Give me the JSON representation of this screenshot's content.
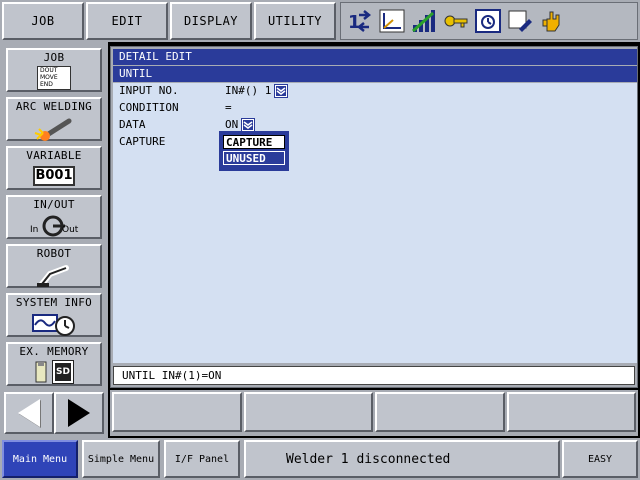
{
  "top_menu": {
    "job": "JOB",
    "edit": "EDIT",
    "display": "DISPLAY",
    "utility": "UTILITY"
  },
  "status_icons": [
    "coordinate-icon",
    "tool-frame-icon",
    "speed-level-icon",
    "key-security-icon",
    "job-status-icon",
    "edit-mode-icon",
    "hand-servo-icon"
  ],
  "sidebar": {
    "items": [
      {
        "label": "JOB",
        "pic_text": [
          "DOUT",
          "MOVE",
          "END"
        ]
      },
      {
        "label": "ARC WELDING"
      },
      {
        "label": "VARIABLE",
        "pic_text": "B001"
      },
      {
        "label": "IN/OUT",
        "pic_in": "In",
        "pic_out": "Out"
      },
      {
        "label": "ROBOT"
      },
      {
        "label": "SYSTEM INFO"
      },
      {
        "label": "EX. MEMORY",
        "pic_text": "SD"
      }
    ]
  },
  "main": {
    "title": "DETAIL EDIT",
    "subtitle": "UNTIL",
    "fields": [
      {
        "label": "INPUT NO.",
        "value": "IN#() 1"
      },
      {
        "label": "CONDITION",
        "value": "="
      },
      {
        "label": "DATA",
        "value": "ON"
      },
      {
        "label": "CAPTURE",
        "value": ""
      }
    ],
    "popup_options": [
      "CAPTURE",
      "UNUSED"
    ],
    "input_line": "UNTIL IN#(1)=ON"
  },
  "bottom_bar": {
    "main_menu": "Main Menu",
    "simple_menu": "Simple Menu",
    "if_panel": "I/F Panel",
    "message": "Welder 1 disconnected",
    "easy": "EASY"
  },
  "colors": {
    "title_bar": "#2a3b9a",
    "content_bg": "#d4e0f2",
    "panel_gray": "#a8acb4",
    "main_menu_active": "#2f44b8"
  }
}
